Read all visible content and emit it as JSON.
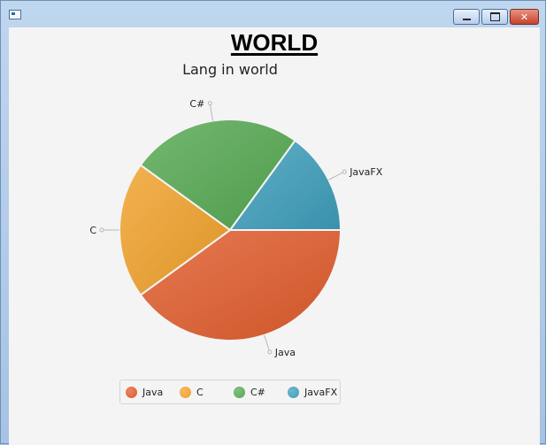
{
  "window": {
    "icon": "app-window-icon",
    "controls": {
      "minimize_icon": "minimize-icon",
      "maximize_icon": "maximize-icon",
      "close_icon": "close-icon",
      "close_glyph": "✕"
    }
  },
  "header": {
    "title": "WORLD"
  },
  "chart_data": {
    "type": "pie",
    "title": "Lang in world",
    "slices": [
      {
        "label": "Java",
        "value": 40,
        "color": "#e05c2c"
      },
      {
        "label": "C",
        "value": 20,
        "color": "#f0a12b"
      },
      {
        "label": "C#",
        "value": 25,
        "color": "#55a952"
      },
      {
        "label": "JavaFX",
        "value": 15,
        "color": "#3e9ebb"
      }
    ],
    "start_angle_deg": 0,
    "direction": "clockwise",
    "legend": {
      "placement": "bottom",
      "entries": [
        "Java",
        "C",
        "C#",
        "JavaFX"
      ]
    }
  }
}
